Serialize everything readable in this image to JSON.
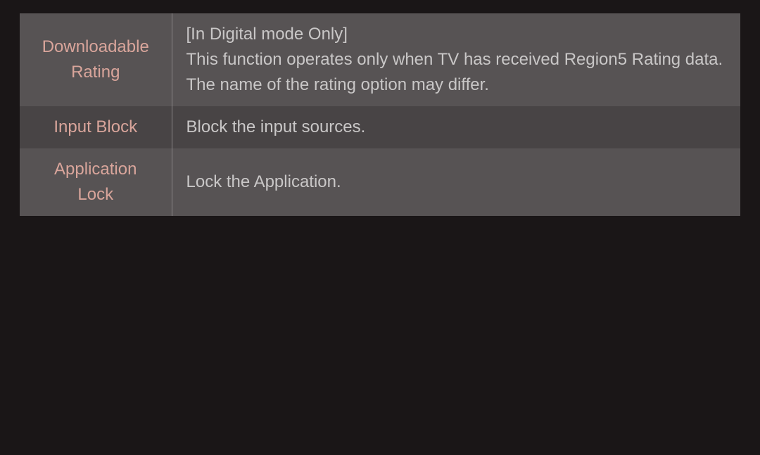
{
  "rows": [
    {
      "label": "Downloadable\nRating",
      "description": "[In Digital mode Only]\nThis function operates only when TV has received Region5 Rating data. The name of the rating option may differ."
    },
    {
      "label": "Input Block",
      "description": "Block the input sources."
    },
    {
      "label": "Application\nLock",
      "description": "Lock the Application."
    }
  ]
}
